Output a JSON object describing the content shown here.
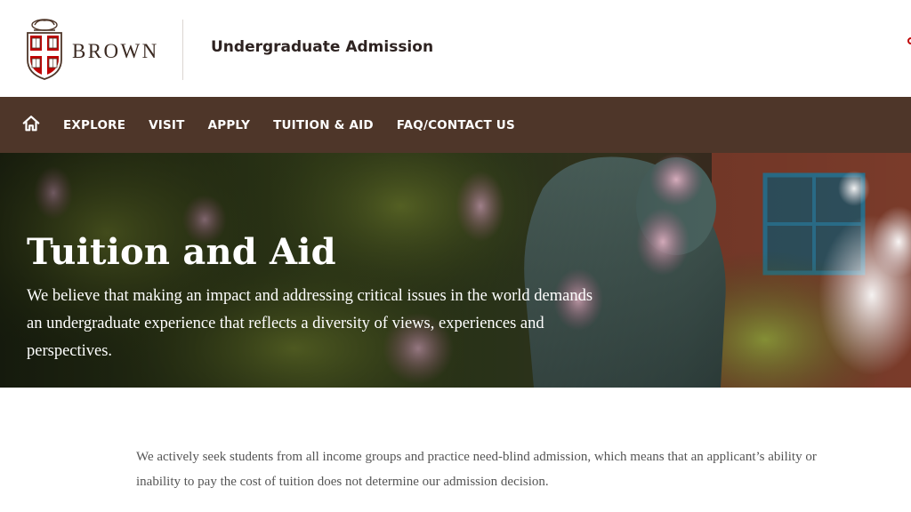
{
  "header": {
    "logo_text": "BROWN",
    "site_title": "Undergraduate Admission"
  },
  "icons": {
    "home": "home-icon",
    "shield": "brown-shield-icon"
  },
  "nav": {
    "items": [
      {
        "label": "EXPLORE"
      },
      {
        "label": "VISIT"
      },
      {
        "label": "APPLY"
      },
      {
        "label": "TUITION & AID"
      },
      {
        "label": "FAQ/CONTACT US"
      }
    ]
  },
  "hero": {
    "title": "Tuition and Aid",
    "text": "We believe that making an impact and addressing critical issues in the world demands an undergraduate experience that reflects a diversity of views, experiences and perspectives."
  },
  "main": {
    "intro": "We actively seek students from all income groups and practice need-blind admission, which means that an applicant’s ability or inability to pay the cost of tuition does not determine our admission decision."
  },
  "colors": {
    "brand_brown": "#4e3629",
    "brand_red": "#c00404",
    "text_dark": "#2e2321"
  }
}
